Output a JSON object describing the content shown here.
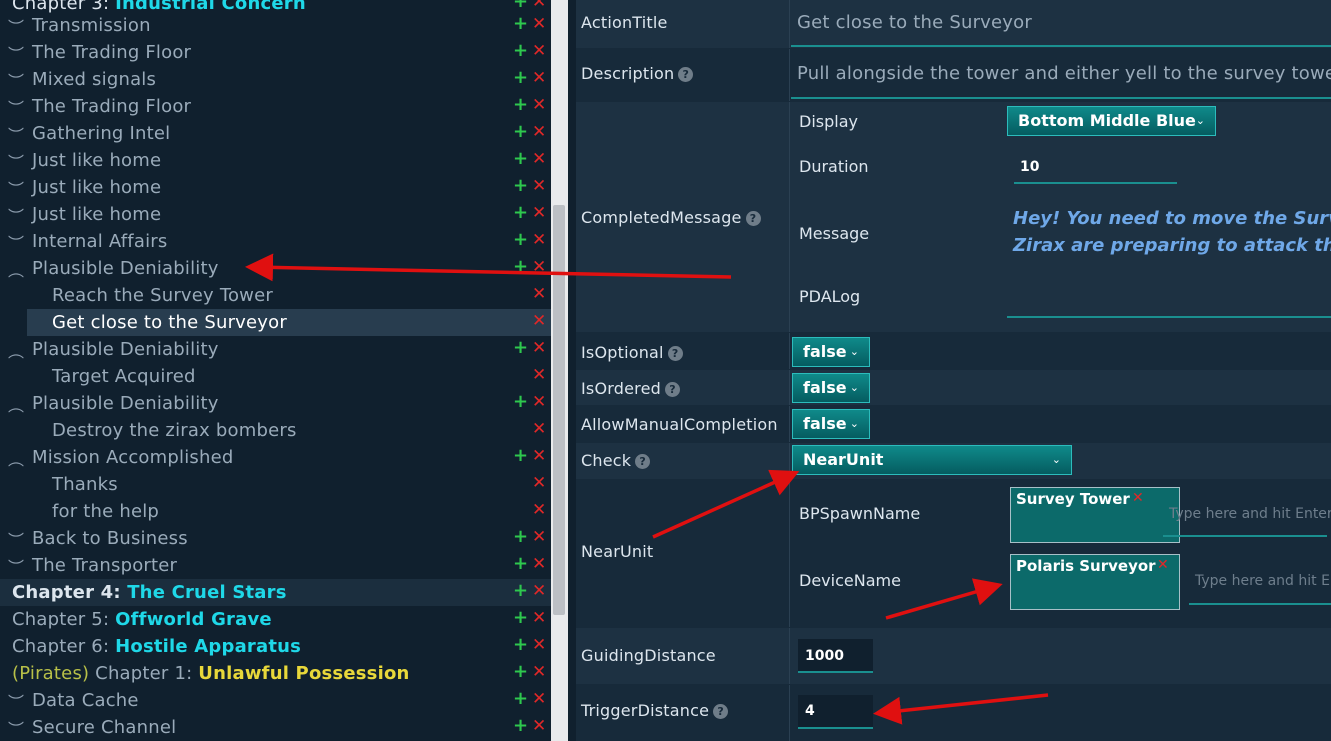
{
  "tree": {
    "items": [
      {
        "caret": "",
        "chapter": "Chapter 3: ",
        "name": "Industrial Concern",
        "plus": "+",
        "x": "✕"
      },
      {
        "caret": "︶",
        "label": "Transmission",
        "plus": "+",
        "x": "✕"
      },
      {
        "caret": "︶",
        "label": "The Trading Floor",
        "plus": "+",
        "x": "✕"
      },
      {
        "caret": "︶",
        "label": "Mixed signals",
        "plus": "+",
        "x": "✕"
      },
      {
        "caret": "︶",
        "label": "The Trading Floor",
        "plus": "+",
        "x": "✕"
      },
      {
        "caret": "︶",
        "label": "Gathering Intel",
        "plus": "+",
        "x": "✕"
      },
      {
        "caret": "︶",
        "label": "Just like home",
        "plus": "+",
        "x": "✕"
      },
      {
        "caret": "︶",
        "label": "Just like home",
        "plus": "+",
        "x": "✕"
      },
      {
        "caret": "︶",
        "label": "Just like home",
        "plus": "+",
        "x": "✕"
      },
      {
        "caret": "︶",
        "label": "Internal Affairs",
        "plus": "+",
        "x": "✕"
      },
      {
        "caret": "︵",
        "label": "Plausible Deniability",
        "plus": "+",
        "x": "✕"
      },
      {
        "caret": "",
        "label": "Reach the Survey Tower",
        "plus": "",
        "x": "✕"
      },
      {
        "caret": "",
        "label": "Get close to the Surveyor",
        "plus": "",
        "x": "✕"
      },
      {
        "caret": "︵",
        "label": "Plausible Deniability",
        "plus": "+",
        "x": "✕"
      },
      {
        "caret": "",
        "label": "Target Acquired",
        "plus": "",
        "x": "✕"
      },
      {
        "caret": "︵",
        "label": "Plausible Deniability",
        "plus": "+",
        "x": "✕"
      },
      {
        "caret": "",
        "label": "Destroy the zirax bombers",
        "plus": "",
        "x": "✕"
      },
      {
        "caret": "︵",
        "label": "Mission Accomplished",
        "plus": "+",
        "x": "✕"
      },
      {
        "caret": "",
        "label": "Thanks",
        "plus": "",
        "x": "✕"
      },
      {
        "caret": "",
        "label": "for the help",
        "plus": "",
        "x": "✕"
      },
      {
        "caret": "︶",
        "label": "Back to Business",
        "plus": "+",
        "x": "✕"
      },
      {
        "caret": "︶",
        "label": "The Transporter",
        "plus": "+",
        "x": "✕"
      },
      {
        "caret": "",
        "chapter": "Chapter 4: ",
        "name": "The Cruel Stars",
        "plus": "+",
        "x": "✕"
      },
      {
        "caret": "",
        "chapter": "Chapter 5: ",
        "name": "Offworld Grave",
        "plus": "+",
        "x": "✕"
      },
      {
        "caret": "",
        "chapter": "Chapter 6: ",
        "name": "Hostile Apparatus",
        "plus": "+",
        "x": "✕"
      },
      {
        "caret": "",
        "faction": "(Pirates)",
        "chapter": " Chapter 1: ",
        "name": "Unlawful Possession",
        "plus": "+",
        "x": "✕"
      },
      {
        "caret": "︶",
        "label": "Data Cache",
        "plus": "+",
        "x": "✕"
      },
      {
        "caret": "︶",
        "label": "Secure Channel",
        "plus": "+",
        "x": "✕"
      }
    ]
  },
  "form": {
    "action_title": {
      "key": "ActionTitle",
      "value": "Get close to the Surveyor"
    },
    "description": {
      "key": "Description",
      "help": "?",
      "value": "Pull alongside the tower and either yell to the survey tower"
    },
    "completed_message": {
      "key": "CompletedMessage",
      "help": "?",
      "display": {
        "key": "Display",
        "value": "Bottom Middle Blue",
        "chev": "⌄"
      },
      "duration": {
        "key": "Duration",
        "value": "10"
      },
      "message": {
        "key": "Message",
        "line1": "Hey! You need to move the Survey",
        "line2": "Zirax are preparing to attack the"
      },
      "pdalog": {
        "key": "PDALog"
      }
    },
    "is_optional": {
      "key": "IsOptional",
      "help": "?",
      "value": "false",
      "chev": "⌄"
    },
    "is_ordered": {
      "key": "IsOrdered",
      "help": "?",
      "value": "false",
      "chev": "⌄"
    },
    "allow_manual": {
      "key": "AllowManualCompletion",
      "value": "false",
      "chev": "⌄"
    },
    "check": {
      "key": "Check",
      "help": "?",
      "value": "NearUnit",
      "chev": "⌄"
    },
    "near_unit": {
      "key": "NearUnit",
      "bp_spawn": {
        "key": "BPSpawnName",
        "tag": "Survey Tower",
        "tag_x": "✕",
        "placeholder": "Type here and hit Enter"
      },
      "device": {
        "key": "DeviceName",
        "tag": "Polaris Surveyor",
        "tag_x": "✕",
        "placeholder": "Type here and hit Enter"
      }
    },
    "guiding_distance": {
      "key": "GuidingDistance",
      "value": "1000"
    },
    "trigger_distance": {
      "key": "TriggerDistance",
      "help": "?",
      "value": "4"
    }
  },
  "colors": {
    "tree_bg": "#10202e",
    "form_bg": "#172a3a",
    "accent_teal": "#0f8a8a",
    "chapter_cyan": "#1fd8e8",
    "pirate_yellow": "#e8d83a",
    "add_green": "#2ec84e",
    "delete_red": "#e02828",
    "arrow_red": "#e01010"
  }
}
